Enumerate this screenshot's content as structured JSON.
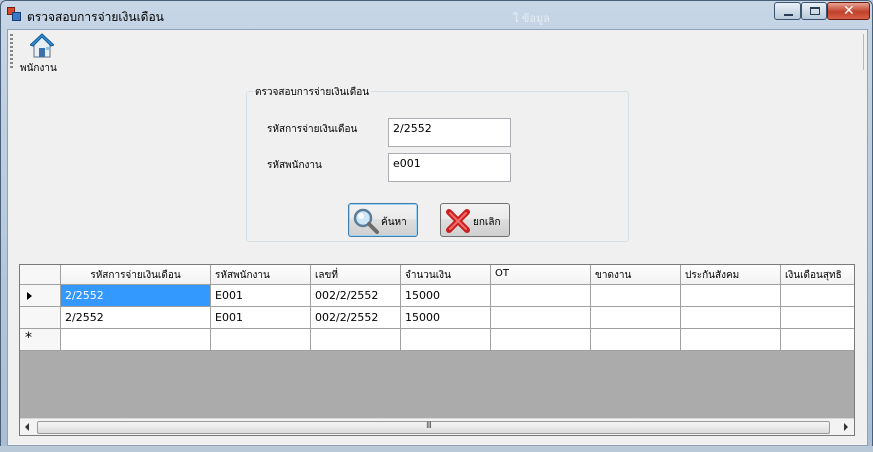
{
  "window": {
    "title": "ตรวจสอบการจ่ายเงินเดือน",
    "ghost_text": "ใ  ข้อมูล"
  },
  "toolbar": {
    "employee_label": "พนักงาน",
    "employee_icon": "home-icon"
  },
  "form": {
    "group_title": "ตรวจสอบการจ่ายเงินเดือน",
    "payment_id_label": "รหัสการจ่ายเงินเดือน",
    "payment_id_value": "2/2552",
    "employee_id_label": "รหัสพนักงาน",
    "employee_id_value": "e001",
    "search_label": "ค้นหา",
    "cancel_label": "ยกเลิก"
  },
  "grid": {
    "columns": [
      "รหัสการจ่ายเงินเดือน",
      "รหัสพนักงาน",
      "เลขที่",
      "จำนวนเงิน",
      "OT",
      "ขาดงาน",
      "ประกันสังคม",
      "เงินเดือนสุทธิ"
    ],
    "rows": [
      [
        "2/2552",
        "E001",
        "002/2/2552",
        "15000",
        "",
        "",
        "",
        ""
      ],
      [
        "2/2552",
        "E001",
        "002/2/2552",
        "15000",
        "",
        "",
        "",
        ""
      ]
    ],
    "new_row_marker": "*",
    "scroll_grip": "III"
  },
  "colors": {
    "selection": "#3399ff",
    "grid_background": "#ababab",
    "close_button": "#c0412a"
  }
}
